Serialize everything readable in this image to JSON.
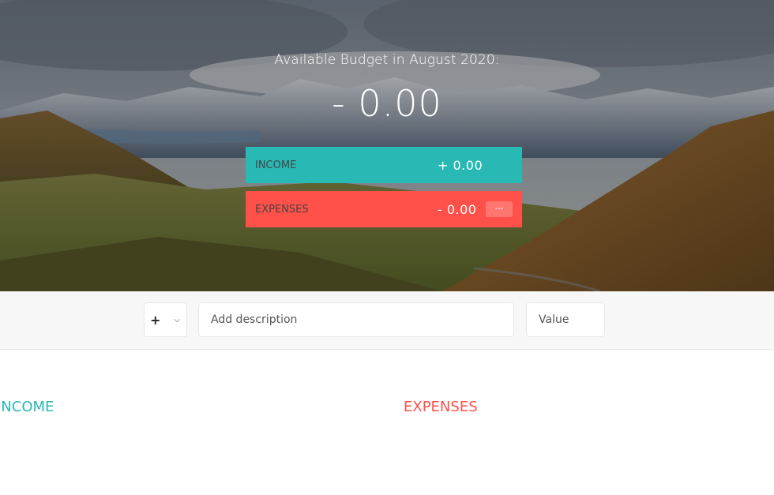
{
  "header": {
    "budget_title": "Available Budget in August 2020:",
    "budget_value": "- 0.00"
  },
  "summary": {
    "income": {
      "label": "INCOME",
      "value": "+ 0.00",
      "color": "#28b9b5"
    },
    "expenses": {
      "label": "EXPENSES",
      "value": "- 0.00",
      "percentage": "---",
      "color": "#ff5049"
    }
  },
  "add_form": {
    "type_selected": "+",
    "type_options": [
      "+",
      "-"
    ],
    "description_placeholder": "Add description",
    "value_placeholder": "Value"
  },
  "lists": {
    "income_title": "INCOME",
    "expenses_title": "EXPENSES"
  },
  "colors": {
    "income": "#28b9b5",
    "expenses": "#ff5049"
  }
}
